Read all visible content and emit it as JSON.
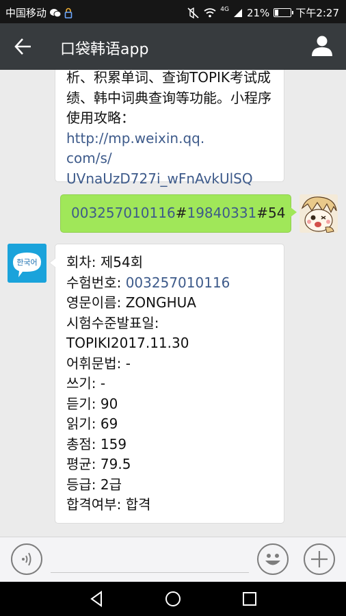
{
  "status_bar": {
    "carrier": "中国移动",
    "battery_percent_text": "21%",
    "battery_level": 0.21,
    "signal_label": "4G",
    "time": "下午2:27",
    "icons": [
      "wechat-icon",
      "lock-icon",
      "mute-vibrate-icon",
      "wifi-icon",
      "signal-icon",
      "battery-icon"
    ]
  },
  "header": {
    "title": "口袋韩语app",
    "back_icon": "back-arrow-icon",
    "profile_icon": "profile-icon"
  },
  "messages": {
    "top_lines": [
      "析、积累单词、查询TOPIK考试成",
      "绩、韩中词典查询等功能。小程序",
      "使用攻略："
    ],
    "top_link_part1": "http://mp.weixin.qq.",
    "top_link_part2": "com/s/",
    "top_link_part3": "UVnaUzD727i_wFnAvkUlSQ",
    "sent_id": "003257010116",
    "sent_sep1": "#",
    "sent_birth": "19840331",
    "sent_sep2": "#",
    "sent_round": "54",
    "bot_avatar_text": "한국어",
    "result": {
      "round": "회차: 제54회",
      "exam_no_label": "수험번호: ",
      "exam_no": "003257010116",
      "english_name": "영문이름: ZONGHUA",
      "level_date_label": "시험수준발표일:",
      "level_date": "TOPIKI2017.11.30",
      "vocab_grammar": "어휘문법: -",
      "writing": "쓰기: -",
      "listening": "듣기: 90",
      "reading": "읽기: 69",
      "total": "총점: 159",
      "average": "평균: 79.5",
      "grade": "등급: 2급",
      "pass": "합격여부: 합격"
    }
  },
  "input_bar": {
    "voice_icon": "voice-input-icon",
    "text_value": "",
    "emoji_icon": "emoji-icon",
    "plus_icon": "plus-icon"
  },
  "nav_bar": {
    "icons": [
      "nav-back-icon",
      "nav-home-icon",
      "nav-recents-icon"
    ]
  },
  "colors": {
    "header_bg": "#373b3e",
    "status_bg": "#161616",
    "chat_bg": "#ebebeb",
    "sent_bubble": "#a0e759",
    "link": "#3d5a8a",
    "bot_avatar": "#1aa3db"
  }
}
